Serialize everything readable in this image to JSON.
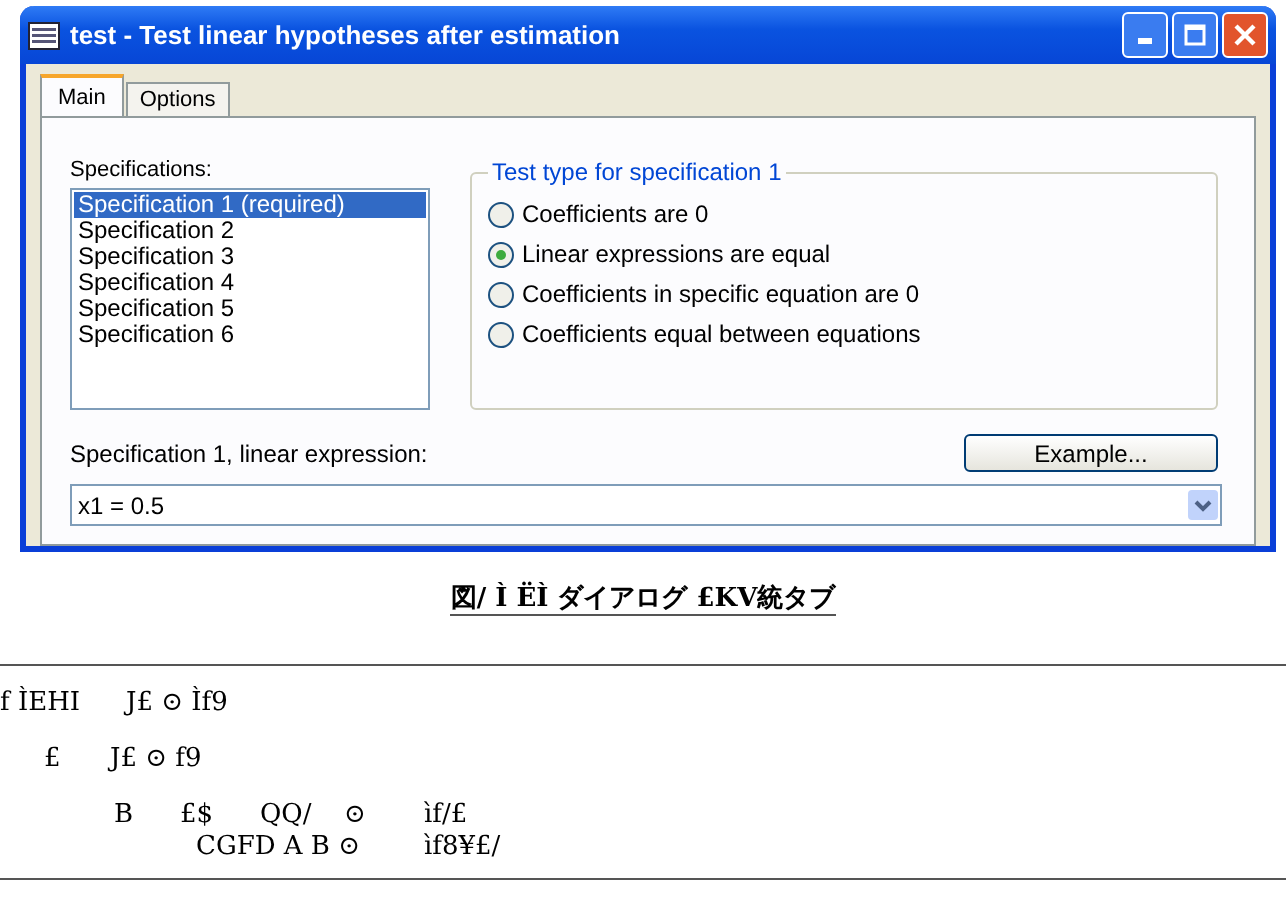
{
  "window": {
    "title": "test - Test linear hypotheses after estimation"
  },
  "tabs": [
    {
      "label": "Main",
      "selected": true
    },
    {
      "label": "Options",
      "selected": false
    }
  ],
  "specifications": {
    "label": "Specifications:",
    "items": [
      {
        "label": "Specification 1 (required)",
        "selected": true
      },
      {
        "label": "Specification 2",
        "selected": false
      },
      {
        "label": "Specification 3",
        "selected": false
      },
      {
        "label": "Specification 4",
        "selected": false
      },
      {
        "label": "Specification 5",
        "selected": false
      },
      {
        "label": "Specification 6",
        "selected": false
      }
    ]
  },
  "test_type": {
    "title": "Test type for specification 1",
    "options": [
      {
        "label": "Coefficients are 0",
        "selected": false
      },
      {
        "label": "Linear expressions are equal",
        "selected": true
      },
      {
        "label": "Coefficients in specific equation are 0",
        "selected": false
      },
      {
        "label": "Coefficients equal between equations",
        "selected": false
      }
    ]
  },
  "expression": {
    "label": "Specification 1, linear expression:",
    "value": "x1 = 0.5"
  },
  "example_button": "Example...",
  "caption": "図/ Ì ËÌ ダイアログ £KV統タブ",
  "table": {
    "lines": [
      [
        "f ÌEHI",
        "J£ ⊙ Ìf9"
      ],
      [
        "£",
        "J£ ⊙ f9"
      ],
      [
        "B",
        "£$",
        "QQ/",
        "⊙",
        "ìf/£"
      ],
      [
        "CGFD A B ⊙",
        "ìf8¥£/"
      ]
    ]
  }
}
